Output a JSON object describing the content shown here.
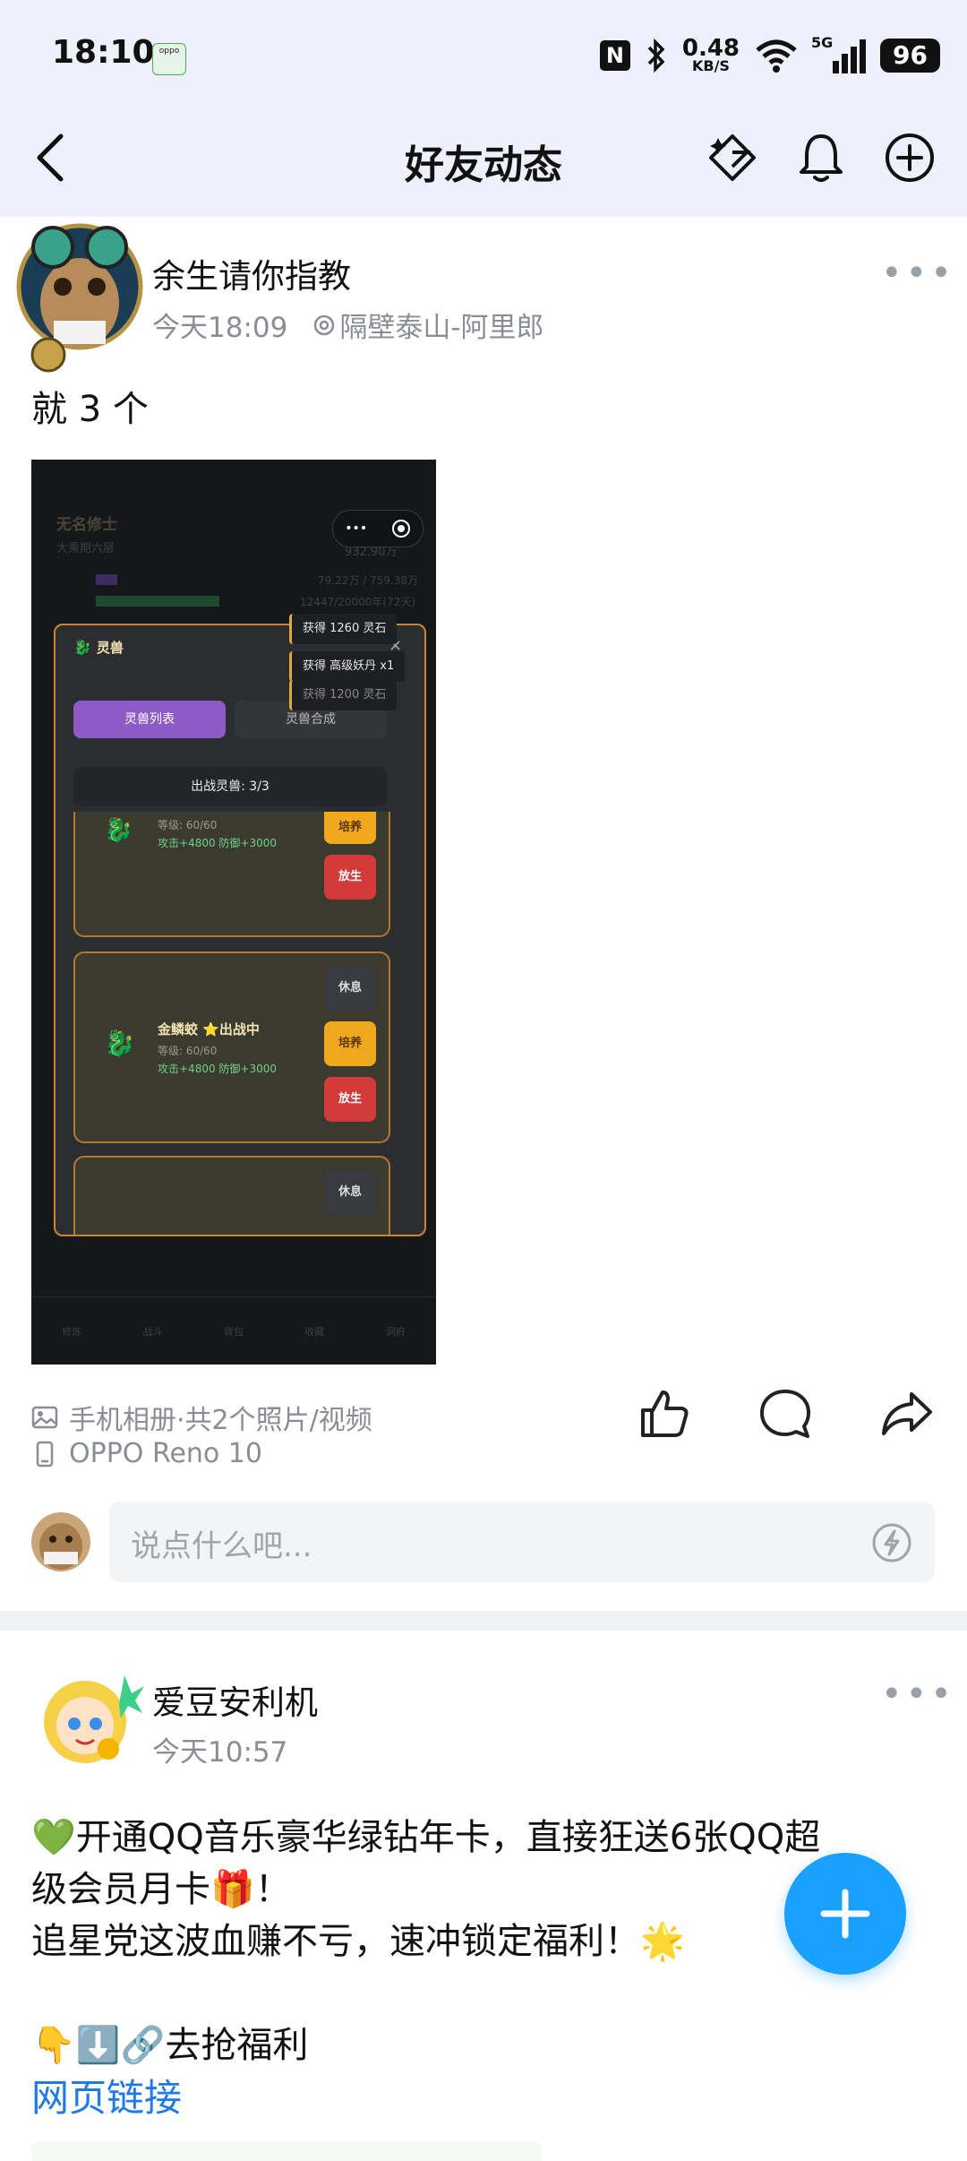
{
  "status_bar": {
    "time": "18:10",
    "net_speed": "0.48",
    "net_unit": "KB/S",
    "signal_label": "5G",
    "battery": "96",
    "app_badge_label": "oppo"
  },
  "header": {
    "title": "好友动态"
  },
  "post1": {
    "author": "余生请你指教",
    "time": "今天18:09",
    "location": "隔壁泰山-阿里郎",
    "text": "就 3 个",
    "album_info": "手机相册·共2个照片/视频",
    "device": "OPPO Reno 10",
    "comment_placeholder": "说点什么吧..."
  },
  "game_screenshot": {
    "player_name": "无名修士",
    "realm": "大乘期六层",
    "currency": "932.90万",
    "cultivation": "79.22万 / 759.38万",
    "life": "12447/20000年(72天)",
    "menu_dots": "•••",
    "modal_title": "灵兽",
    "tab_active": "灵兽列表",
    "tab_inactive": "灵兽合成",
    "battle_count": "出战灵兽: 3/3",
    "toasts": [
      "获得 1260 灵石",
      "获得 高级妖丹 x1",
      "获得 1200 灵石"
    ],
    "pets": [
      {
        "name": "",
        "level": "等级: 60/60",
        "stats": "攻击+4800 防御+3000",
        "btn_train": "培养",
        "btn_free": "放生"
      },
      {
        "name": "金鳞蛟 ⭐出战中",
        "level": "等级: 60/60",
        "stats": "攻击+4800 防御+3000",
        "btn_rest": "休息",
        "btn_train": "培养",
        "btn_free": "放生"
      },
      {
        "btn_rest": "休息"
      }
    ],
    "bottom_nav": [
      "修炼",
      "战斗",
      "背包",
      "收藏",
      "洞府"
    ]
  },
  "post2": {
    "author": "爱豆安利机",
    "time": "今天10:57",
    "line1": "💚开通QQ音乐豪华绿钻年卡，直接狂送6张QQ超",
    "line2": "级会员月卡🎁！",
    "line3": "追星党这波血赚不亏，速冲锁定福利！🌟",
    "line4": "👇⬇️🔗去抢福利",
    "link": "网页链接"
  },
  "colors": {
    "accent": "#1aa0ff",
    "link": "#1f7ae8",
    "header_bg": "#eef0fb"
  }
}
